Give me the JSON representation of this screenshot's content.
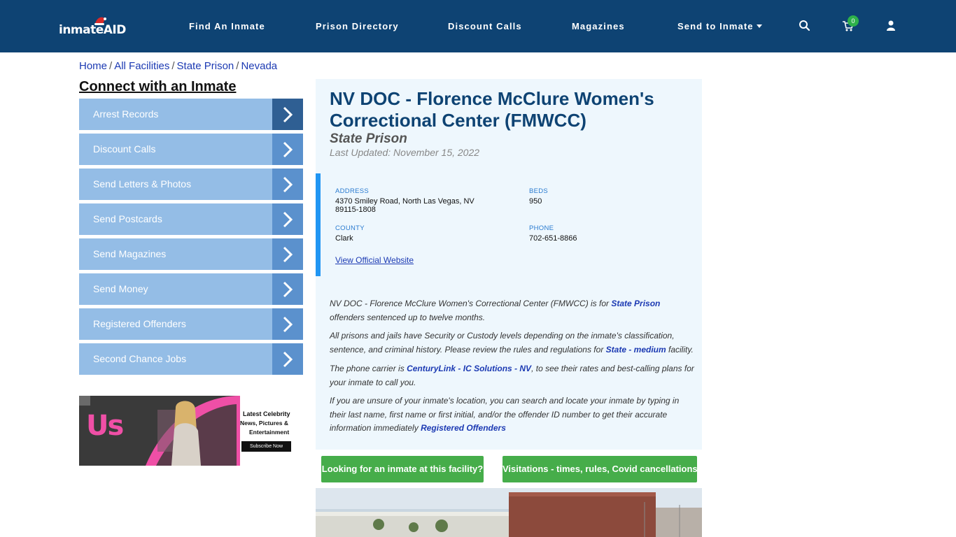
{
  "header": {
    "logo_text": "inmateAID",
    "nav": [
      "Find An Inmate",
      "Prison Directory",
      "Discount Calls",
      "Magazines",
      "Send to Inmate"
    ],
    "cart_count": "0",
    "colors": {
      "bar": "#0e4373",
      "badge": "#2db14a"
    }
  },
  "breadcrumb": [
    "Home",
    "All Facilities",
    "State Prison",
    "Nevada"
  ],
  "sidebar": {
    "title": "Connect with an Inmate",
    "items": [
      "Arrest Records",
      "Discount Calls",
      "Send Letters & Photos",
      "Send Postcards",
      "Send Magazines",
      "Send Money",
      "Registered Offenders",
      "Second Chance Jobs"
    ]
  },
  "ad": {
    "brand": "Us",
    "tagline_1": "Latest Celebrity",
    "tagline_2": "News, Pictures &",
    "tagline_3": "Entertainment",
    "button": "Subscribe Now"
  },
  "facility": {
    "title": "NV DOC - Florence McClure Women's Correctional Center (FMWCC)",
    "type": "State Prison",
    "updated": "Last Updated: November 15, 2022",
    "address_label": "ADDRESS",
    "address_line1": "4370 Smiley Road, North Las Vegas, NV",
    "address_line2": "89115-1808",
    "beds_label": "BEDS",
    "beds": "950",
    "county_label": "COUNTY",
    "county": "Clark",
    "phone_label": "PHONE",
    "phone": "702-651-8866",
    "website_link": "View Official Website"
  },
  "description": {
    "p1_a": "NV DOC - Florence McClure Women's Correctional Center (FMWCC) is for ",
    "p1_link": "State Prison",
    "p1_b": "offenders sentenced up to twelve months.",
    "p2_a": "All prisons and jails have Security or Custody levels depending on the inmate's classification, sentence, and criminal history. Please review the rules and regulations for ",
    "p2_link": "State - medium",
    "p2_b": " facility.",
    "p3_a": "The phone carrier is ",
    "p3_link": "CenturyLink - IC Solutions - NV",
    "p3_b": ", to see their rates and best-calling plans for your inmate to call you.",
    "p4_a": "If you are unsure of your inmate's location, you can search and locate your inmate by typing in their last name, first name or first initial, and/or the offender ID number to get their accurate information immediately ",
    "p4_link": "Registered Offenders"
  },
  "buttons": {
    "find_inmate": "Looking for an inmate at this facility?",
    "visitation": "Visitations - times, rules, Covid cancellations"
  }
}
